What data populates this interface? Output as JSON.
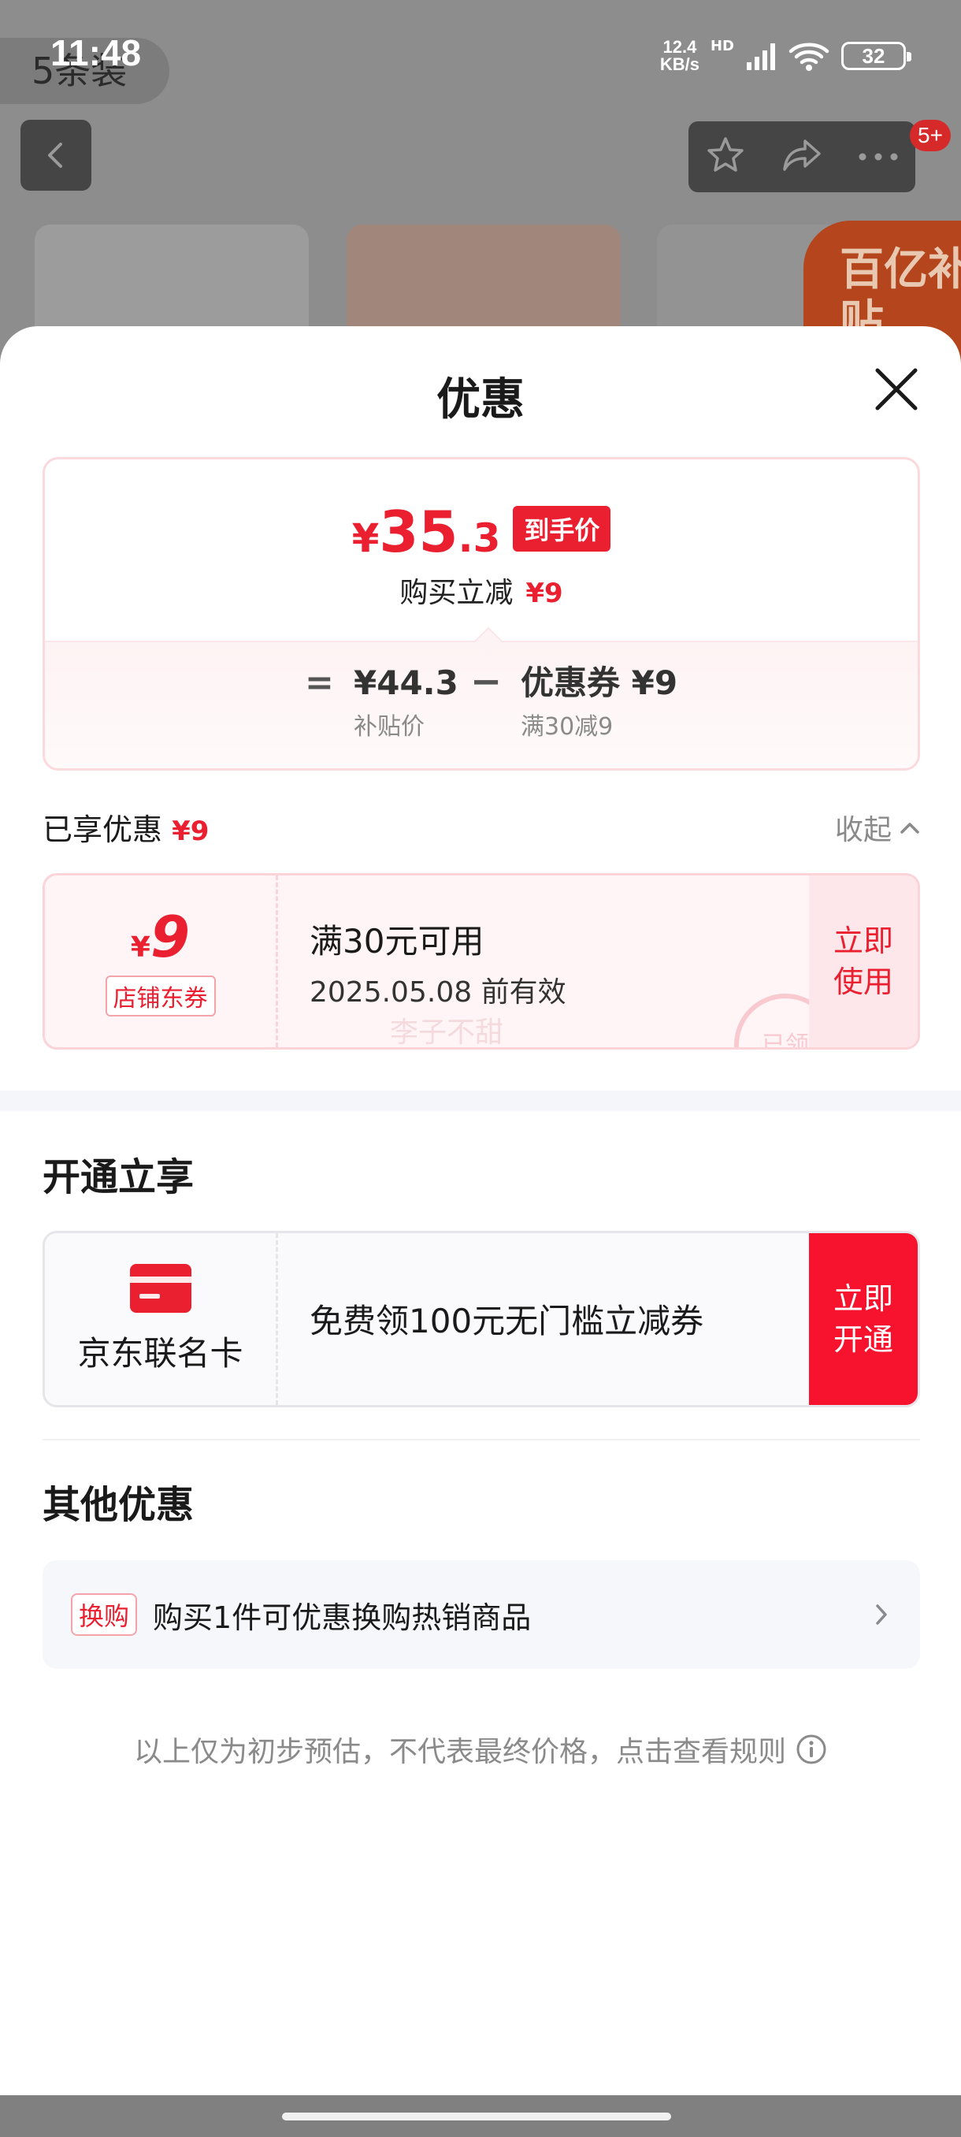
{
  "status_bar": {
    "time": "11:48",
    "net_speed_value": "12.4",
    "net_speed_unit": "KB/s",
    "hd": "HD",
    "battery": "32"
  },
  "background": {
    "title": "5条装",
    "badge": "5+",
    "subsidy": "百亿补贴"
  },
  "sheet": {
    "title": "优惠",
    "price": {
      "currency": "¥",
      "integer": "35",
      "decimal": ".3",
      "tag": "到手价",
      "instant_label": "购买立减",
      "instant_value": "¥9",
      "equals": "=",
      "base_value": "¥44.3",
      "base_label": "补贴价",
      "minus": "−",
      "coupon_value": "优惠券 ¥9",
      "coupon_label": "满30减9"
    },
    "enjoyed": {
      "label": "已享优惠",
      "value": "¥9",
      "collapse": "收起"
    },
    "coupon": {
      "currency": "¥",
      "amount": "9",
      "type": "店铺东券",
      "condition": "满30元可用",
      "expiry": "2025.05.08 前有效",
      "watermark": "李子不甜",
      "stamp": "已领",
      "action_line1": "立即",
      "action_line2": "使用"
    },
    "membership": {
      "section_title": "开通立享",
      "card_name": "京东联名卡",
      "desc": "免费领100元无门槛立减券",
      "action_line1": "立即",
      "action_line2": "开通"
    },
    "other": {
      "section_title": "其他优惠",
      "tag": "换购",
      "text": "购买1件可优惠换购热销商品"
    },
    "disclaimer": "以上仅为初步预估，不代表最终价格，点击查看规则"
  },
  "icons": [
    "back-icon",
    "star-icon",
    "share-icon",
    "more-icon",
    "close-icon",
    "chevron-up-icon",
    "chevron-right-icon",
    "info-icon",
    "card-icon",
    "signal-icon",
    "wifi-icon"
  ],
  "colors": {
    "accent": "#ea1f2f",
    "open_button": "#f7132e"
  }
}
